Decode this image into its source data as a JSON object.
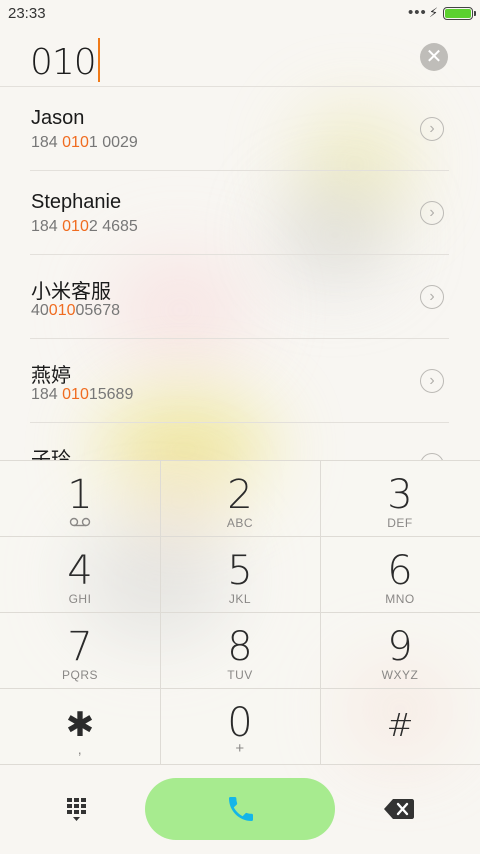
{
  "status": {
    "time": "23:33",
    "more": "•••",
    "charging": "⚡",
    "battery_level": 1.0,
    "battery_color": "#5bd12e"
  },
  "dialer": {
    "input_value": "010",
    "clear_icon": "clear-circle-icon"
  },
  "highlight_color": "#f06c20",
  "contacts": [
    {
      "name": "Jason",
      "num_pre": "184 ",
      "num_match": "010",
      "num_post": "1 0029"
    },
    {
      "name": "Stephanie",
      "num_pre": "184 ",
      "num_match": "010",
      "num_post": "2 4685"
    },
    {
      "name": "小米客服",
      "num_pre": "40",
      "num_match": "010",
      "num_post": "05678"
    },
    {
      "name": "燕婷",
      "num_pre": "184 ",
      "num_match": "010",
      "num_post": "15689"
    },
    {
      "name": "子玲",
      "num_pre": "",
      "num_match": "",
      "num_post": ""
    }
  ],
  "keys": [
    {
      "digit": "1",
      "letters": "",
      "icon": "voicemail-icon"
    },
    {
      "digit": "2",
      "letters": "ABC"
    },
    {
      "digit": "3",
      "letters": "DEF"
    },
    {
      "digit": "4",
      "letters": "GHI"
    },
    {
      "digit": "5",
      "letters": "JKL"
    },
    {
      "digit": "6",
      "letters": "MNO"
    },
    {
      "digit": "7",
      "letters": "PQRS"
    },
    {
      "digit": "8",
      "letters": "TUV"
    },
    {
      "digit": "9",
      "letters": "WXYZ"
    },
    {
      "digit": "✱",
      "letters": ","
    },
    {
      "digit": "0",
      "letters": "+"
    },
    {
      "digit": "#",
      "letters": ""
    }
  ],
  "bottom_bar": {
    "keypad_toggle_icon": "dialpad-icon",
    "call_icon": "phone-icon",
    "call_color": "#a7eb8f",
    "delete_icon": "backspace-icon"
  }
}
